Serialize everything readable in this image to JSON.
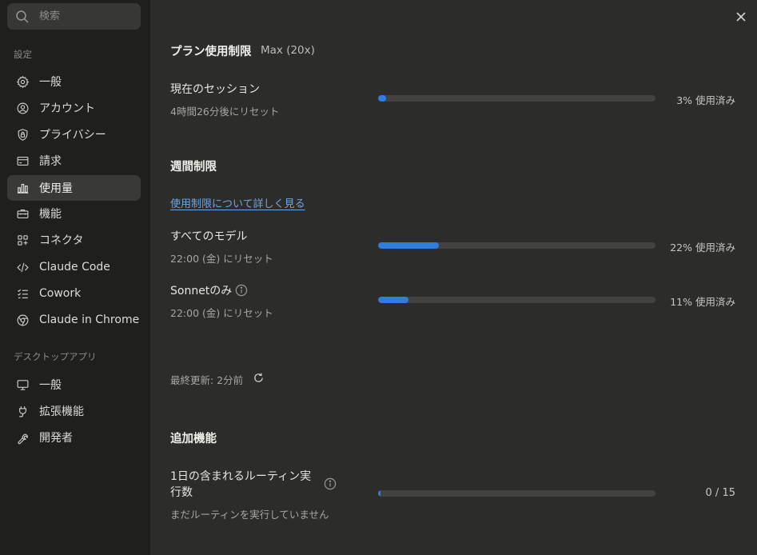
{
  "search": {
    "placeholder": "検索"
  },
  "sidebar": {
    "settings_label": "設定",
    "items": [
      {
        "label": "一般",
        "icon": "gear-icon"
      },
      {
        "label": "アカウント",
        "icon": "user-circle-icon"
      },
      {
        "label": "プライバシー",
        "icon": "shield-lock-icon"
      },
      {
        "label": "請求",
        "icon": "credit-card-icon"
      },
      {
        "label": "使用量",
        "icon": "bar-chart-icon",
        "active": true
      },
      {
        "label": "機能",
        "icon": "toolbox-icon"
      },
      {
        "label": "コネクタ",
        "icon": "connector-icon"
      },
      {
        "label": "Claude Code",
        "icon": "code-icon"
      },
      {
        "label": "Cowork",
        "icon": "checklist-icon"
      },
      {
        "label": "Claude in Chrome",
        "icon": "globe-icon"
      }
    ],
    "desktop_label": "デスクトップアプリ",
    "desktop_items": [
      {
        "label": "一般",
        "icon": "monitor-icon"
      },
      {
        "label": "拡張機能",
        "icon": "plug-icon"
      },
      {
        "label": "開発者",
        "icon": "wrench-icon"
      }
    ]
  },
  "plan": {
    "title": "プラン使用制限",
    "name": "Max (20x)",
    "session": {
      "title": "現在のセッション",
      "reset": "4時間26分後にリセット",
      "progress": 3,
      "pct_label": "3% 使用済み"
    }
  },
  "weekly": {
    "title": "週間制限",
    "link": "使用制限について詳しく見る",
    "all_models": {
      "title": "すべてのモデル",
      "reset": "22:00 (金) にリセット",
      "progress": 22,
      "pct_label": "22% 使用済み"
    },
    "sonnet": {
      "title": "Sonnetのみ",
      "reset": "22:00 (金) にリセット",
      "progress": 11,
      "pct_label": "11% 使用済み"
    },
    "last_updated": "最終更新: 2分前"
  },
  "extra": {
    "title": "追加機能",
    "routine": {
      "title_line1": "1日の含まれるルーティン実",
      "title_line2": "行数",
      "sub": "まだルーティンを実行していません",
      "used": 0,
      "total": 15,
      "count_label": "0 / 15"
    }
  },
  "colors": {
    "accent": "#2f7de0",
    "link": "#6fa6e3",
    "sidebar_bg": "#1f1f1e",
    "main_bg": "#2c2c2b"
  }
}
